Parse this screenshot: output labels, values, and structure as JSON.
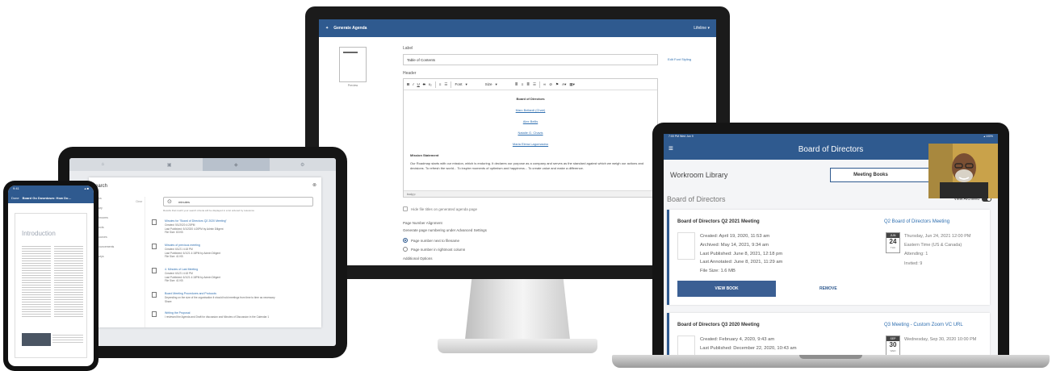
{
  "monitor": {
    "header": {
      "title": "Generate Agenda",
      "user": "Lifeline"
    },
    "thumbnail_caption": "Preview",
    "label_field": {
      "label": "Label",
      "value": "Table of Contents"
    },
    "edit_link": "Edit Font Styling",
    "header_label": "Header",
    "toolbar": {
      "font": "Font",
      "size": "Size"
    },
    "editor": {
      "heading": "Board of Directors",
      "links": [
        "Marc Bellardi (Chair)",
        "Alex Bellis",
        "Natalie G. Chavis",
        "Maria Elena Lagomasino"
      ],
      "mission_heading": "Mission Statement",
      "mission_text": "Our Roadmap starts with our mission, which is enduring. It declares our purpose as a company and serves as the standard against which we weigh our actions and decisions. To refresh the world... To inspire moments of optimism and happiness... To create value and make a difference.",
      "statusbar": "body  p"
    },
    "hide_checkbox": "Hide file titles on generated agenda page",
    "page_number_alignment": "Page Number Alignment",
    "generate_note": "Generate page numbering under Advanced Settings",
    "radio_next": "Page number next to filename",
    "radio_right": "Page number in rightmost column",
    "additional_options": "Additional Options"
  },
  "tablet": {
    "title": "Search",
    "search_value": "minutes",
    "hint": "Results that match your search criteria will be displayed in a list ordered by relevance",
    "sidebar": [
      "Books",
      "Library",
      "Workrooms",
      "Projects",
      "Resources",
      "Announcements",
      "Surveys"
    ],
    "sidebar_link": "Clear",
    "results": [
      {
        "title": "Minutes for \"Board of Directors Q2 2020 Meeting\"",
        "lines": [
          "Created: 5/1/2020 4:20PM",
          "Last Published: 5/1/2020 4:20PM by Admin Diligent",
          "File Size: 63 KB"
        ]
      },
      {
        "title": "Minutes of previous meeting",
        "lines": [
          "Created: 6/1/21 4:18 PM",
          "Last Published: 6/1/21 4:18PM by Admin Diligent",
          "File Size: 41 KB"
        ]
      },
      {
        "title": "4. Minutes of Last Meeting",
        "lines": [
          "Created: 6/1/21 4:18 PM",
          "Last Published: 6/1/21 4:18PM by Admin Diligent",
          "File Size: 41 KB"
        ]
      },
      {
        "title": "Board Meeting Procedures and Protocols",
        "lines": [
          "Depending on the size of the organisation it should hold meetings from time to time as necessary",
          "Share"
        ]
      },
      {
        "title": "Writing the Proposal",
        "lines": [
          "I reviewed the Agenda and Draft for discussion and Minutes of Discussion in the Calendar 1"
        ]
      }
    ]
  },
  "phone": {
    "time": "9:41",
    "status_right": "▴ ■",
    "done": "Done",
    "doc_title": "Board Go Downtown: How Do…",
    "page_heading": "Introduction"
  },
  "laptop": {
    "status": {
      "left": "7:00 PM  Wed Jun 9",
      "right": "▴ 100%"
    },
    "title": "Board of Directors",
    "workroom_library": "Workroom Library",
    "tabs": {
      "meeting_books": "Meeting Books",
      "other": ""
    },
    "section": "Board of Directors",
    "view_archived": "View Archived",
    "cards": [
      {
        "title": "Board of Directors Q2 2021 Meeting",
        "link": "Q2 Board of Directors Meeting",
        "meta": [
          "Created: April 19, 2020, 11:53 am",
          "Archived: May 14, 2021, 9:34 am",
          "Last Published: June 8, 2021, 12:18 pm",
          "Last Annotated: June 8, 2021, 11:29 am",
          "File Size: 1.6 MB"
        ],
        "cal": {
          "month": "JUN",
          "day": "24",
          "weekday": "THU"
        },
        "event": [
          "Thursday, Jun 24, 2021 12:00 PM",
          "Eastern Time (US & Canada)",
          "Attending: 1",
          "Invited: 9"
        ],
        "view_button": "VIEW BOOK",
        "remove": "REMOVE"
      },
      {
        "title": "Board of Directors Q3 2020 Meeting",
        "link": "Q3 Meeting - Custom Zoom VC URL",
        "meta": [
          "Created: February 4, 2020, 9:43 am",
          "Last Published: December 22, 2020, 10:43 am"
        ],
        "cal": {
          "month": "SEP",
          "day": "30",
          "weekday": "WED"
        },
        "event": [
          "Wednesday, Sep 30, 2020 10:00 PM"
        ],
        "view_button": "",
        "remove": ""
      }
    ]
  },
  "colors": {
    "brand": "#2f5a8f",
    "link": "#2f6fb0"
  }
}
